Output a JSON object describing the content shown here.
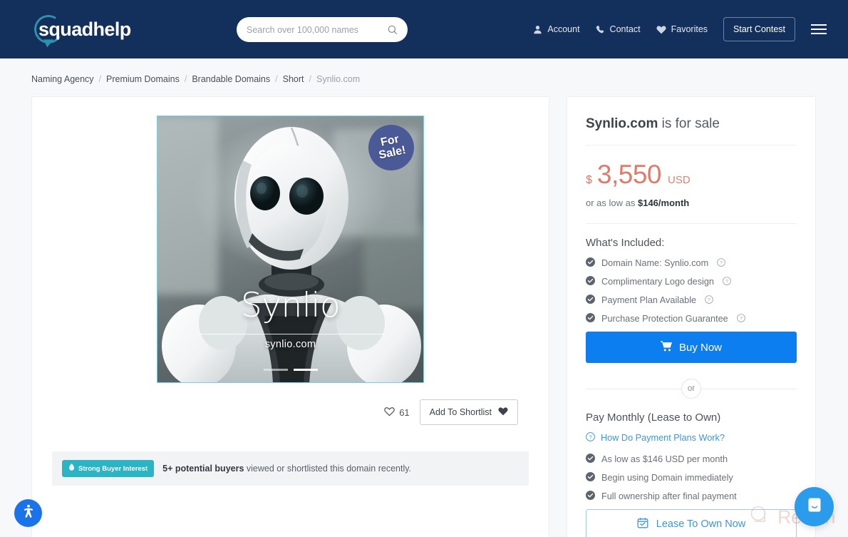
{
  "header": {
    "logo_text": "squadhelp",
    "search": {
      "placeholder": "Search over 100,000 names",
      "value": "",
      "icon": "search-icon"
    },
    "nav": [
      {
        "label": "Account",
        "icon": "user-icon"
      },
      {
        "label": "Contact",
        "icon": "phone-icon"
      },
      {
        "label": "Favorites",
        "icon": "heart-icon"
      }
    ],
    "start_contest_label": "Start Contest",
    "menu_icon": "hamburger-menu-icon",
    "background_color": "#13305c"
  },
  "breadcrumb": {
    "items": [
      {
        "label": "Naming Agency",
        "current": false
      },
      {
        "label": "Premium Domains",
        "current": false
      },
      {
        "label": "Brandable Domains",
        "current": false
      },
      {
        "label": "Short",
        "current": false
      },
      {
        "label": "Synlio.com",
        "current": true
      }
    ],
    "separator": "/"
  },
  "product": {
    "image": {
      "overlay_title": "Synlio",
      "overlay_subtitle": "synlio.com",
      "badge_line1": "For",
      "badge_line2": "Sale!",
      "badge_color": "#4a5a96",
      "frame_border_color": "#7ecfdd",
      "alt": "white humanoid robot",
      "carousel": {
        "total": 2,
        "active_index": 1
      }
    },
    "favorites_count": "61",
    "favorites_icon": "heart-outline-icon",
    "shortlist_button_label": "Add To Shortlist",
    "shortlist_button_icon": "heart-filled-icon",
    "buyer_interest": {
      "badge_label": "Strong Buyer Interest",
      "badge_icon": "flame-icon",
      "badge_color": "#29b5c4",
      "highlight": "5+ potential buyers",
      "text": " viewed or shortlisted this domain recently."
    }
  },
  "sale_panel": {
    "title_domain": "Synlio.com",
    "title_rest": " is for sale",
    "price": {
      "currency_symbol": "$",
      "amount": "3,550",
      "currency_code": "USD",
      "color": "#e07a6a"
    },
    "monthly_prefix": "or as low as ",
    "monthly_amount": "$146/month",
    "included_title": "What's Included:",
    "included_items": [
      {
        "label": "Domain Name: Synlio.com",
        "has_help": true
      },
      {
        "label": "Complimentary Logo design",
        "has_help": true
      },
      {
        "label": "Payment Plan Available",
        "has_help": true
      },
      {
        "label": "Purchase Protection Guarantee",
        "has_help": true
      }
    ],
    "buy_button": {
      "label": "Buy Now",
      "icon": "shopping-cart-icon",
      "color": "#0d7ef0"
    },
    "or_label": "or",
    "pay_monthly_title": "Pay Monthly (Lease to Own)",
    "plans_link": {
      "label": "How Do Payment Plans Work?",
      "icon": "question-circle-icon",
      "color": "#3e95e0"
    },
    "plan_items": [
      {
        "label": "As low as $146 USD per month"
      },
      {
        "label": "Begin using Domain immediately"
      },
      {
        "label": "Full ownership after final payment"
      }
    ],
    "lease_button": {
      "label": "Lease To Own Now",
      "icon": "calendar-icon"
    }
  },
  "widgets": {
    "accessibility": {
      "icon": "accessibility-icon",
      "color": "#1a73e8"
    },
    "chat": {
      "icon": "chat-bubble-icon",
      "color": "#2b9cec"
    },
    "watermark": {
      "text": "Revain",
      "icon": "revain-logo-icon"
    }
  }
}
